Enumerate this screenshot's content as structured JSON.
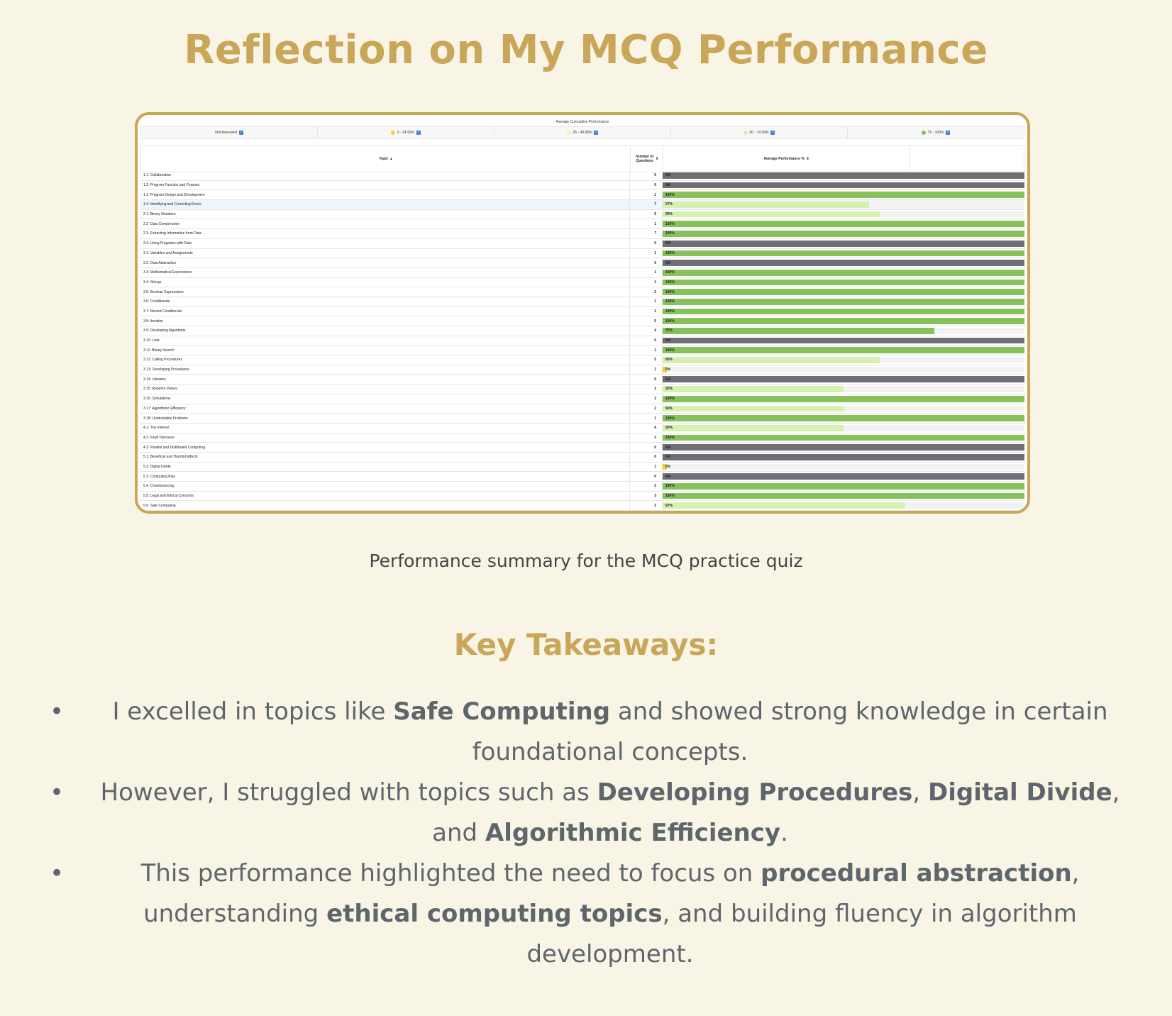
{
  "title": "Reflection on My MCQ Performance",
  "screenshot": {
    "header": "Average Cumulative Performance",
    "legend": [
      {
        "label": "Not Assessed",
        "color": ""
      },
      {
        "label": "0 - 24.99%",
        "color": "#f2d230"
      },
      {
        "label": "25 - 49.99%",
        "color": "#f6eeb4"
      },
      {
        "label": "50 - 74.99%",
        "color": "#d4f1b0"
      },
      {
        "label": "75 - 100%",
        "color": "#86c15c"
      }
    ],
    "columns": {
      "topic": "Topic",
      "num": "Number of Questions",
      "perf": "Average Performance %"
    },
    "rows": [
      {
        "topic": "1.1:  Collaboration",
        "num": "0",
        "pct": null,
        "label": "NA"
      },
      {
        "topic": "1.2:  Program Function and Purpose",
        "num": "0",
        "pct": null,
        "label": "NA"
      },
      {
        "topic": "1.3:  Program Design and Development",
        "num": "1",
        "pct": 100,
        "label": "100%"
      },
      {
        "topic": "1.4:  Identifying and Correcting Errors",
        "num": "7",
        "pct": 57,
        "label": "57%"
      },
      {
        "topic": "2.1:  Binary Numbers",
        "num": "5",
        "pct": 60,
        "label": "60%"
      },
      {
        "topic": "2.2:  Data Compression",
        "num": "1",
        "pct": 100,
        "label": "100%"
      },
      {
        "topic": "2.3:  Extracting Information from Data",
        "num": "7",
        "pct": 100,
        "label": "100%"
      },
      {
        "topic": "2.4:  Using Programs with Data",
        "num": "0",
        "pct": null,
        "label": "NA"
      },
      {
        "topic": "3.1:  Variables and Assignments",
        "num": "1",
        "pct": 100,
        "label": "100%"
      },
      {
        "topic": "3.2:  Data Abstraction",
        "num": "0",
        "pct": null,
        "label": "NA"
      },
      {
        "topic": "3.3:  Mathematical Expressions",
        "num": "1",
        "pct": 100,
        "label": "100%"
      },
      {
        "topic": "3.4:  Strings",
        "num": "1",
        "pct": 100,
        "label": "100%"
      },
      {
        "topic": "3.5:  Boolean Expressions",
        "num": "2",
        "pct": 100,
        "label": "100%"
      },
      {
        "topic": "3.6:  Conditionals",
        "num": "1",
        "pct": 100,
        "label": "100%"
      },
      {
        "topic": "3.7:  Nested Conditionals",
        "num": "2",
        "pct": 100,
        "label": "100%"
      },
      {
        "topic": "3.8:  Iteration",
        "num": "5",
        "pct": 100,
        "label": "100%"
      },
      {
        "topic": "3.9:  Developing Algorithms",
        "num": "4",
        "pct": 75,
        "label": "75%"
      },
      {
        "topic": "3.10:  Lists",
        "num": "0",
        "pct": null,
        "label": "NA"
      },
      {
        "topic": "3.11:  Binary Search",
        "num": "1",
        "pct": 100,
        "label": "100%"
      },
      {
        "topic": "3.12:  Calling Procedures",
        "num": "5",
        "pct": 60,
        "label": "60%"
      },
      {
        "topic": "3.13:  Developing Procedures",
        "num": "1",
        "pct": 0,
        "label": "0%"
      },
      {
        "topic": "3.14:  Libraries",
        "num": "0",
        "pct": null,
        "label": "NA"
      },
      {
        "topic": "3.15:  Random Values",
        "num": "2",
        "pct": 50,
        "label": "50%"
      },
      {
        "topic": "3.16:  Simulations",
        "num": "2",
        "pct": 100,
        "label": "100%"
      },
      {
        "topic": "3.17:  Algorithmic Efficiency",
        "num": "2",
        "pct": 50,
        "label": "50%"
      },
      {
        "topic": "3.18:  Undecidable Problems",
        "num": "1",
        "pct": 100,
        "label": "100%"
      },
      {
        "topic": "4.1:  The Internet",
        "num": "4",
        "pct": 50,
        "label": "50%"
      },
      {
        "topic": "4.2:  Fault Tolerance",
        "num": "2",
        "pct": 100,
        "label": "100%"
      },
      {
        "topic": "4.3:  Parallel and Distributed Computing",
        "num": "0",
        "pct": null,
        "label": "NA"
      },
      {
        "topic": "5.1:  Beneficial and Harmful Effects",
        "num": "0",
        "pct": null,
        "label": "NA"
      },
      {
        "topic": "5.2:  Digital Divide",
        "num": "1",
        "pct": 0,
        "label": "0%"
      },
      {
        "topic": "5.3:  Computing Bias",
        "num": "0",
        "pct": null,
        "label": "NA"
      },
      {
        "topic": "5.4:  Crowdsourcing",
        "num": "2",
        "pct": 100,
        "label": "100%"
      },
      {
        "topic": "5.5:  Legal and Ethical Concerns",
        "num": "3",
        "pct": 100,
        "label": "100%"
      },
      {
        "topic": "5.6:  Safe Computing",
        "num": "3",
        "pct": 67,
        "label": "67%"
      }
    ],
    "colors": {
      "na": "#6f7077",
      "low": "#f2d230",
      "mid": "#d4f1b0",
      "high": "#86c15c"
    }
  },
  "caption": "Performance summary for the MCQ practice quiz",
  "section_title": "Key Takeaways:",
  "takeaways": [
    [
      {
        "t": "I excelled in topics like "
      },
      {
        "b": "Safe Computing"
      },
      {
        "t": " and showed strong knowledge in certain foundational concepts."
      }
    ],
    [
      {
        "t": "However, I struggled with topics such as "
      },
      {
        "b": "Developing Procedures"
      },
      {
        "t": ", "
      },
      {
        "b": "Digital Divide"
      },
      {
        "t": ", and "
      },
      {
        "b": "Algorithmic Efficiency"
      },
      {
        "t": "."
      }
    ],
    [
      {
        "t": "This performance highlighted the need to focus on "
      },
      {
        "b": "procedural abstraction"
      },
      {
        "t": ", understanding "
      },
      {
        "b": "ethical computing topics"
      },
      {
        "t": ", and building fluency in algorithm development."
      }
    ]
  ],
  "bullet": "•"
}
